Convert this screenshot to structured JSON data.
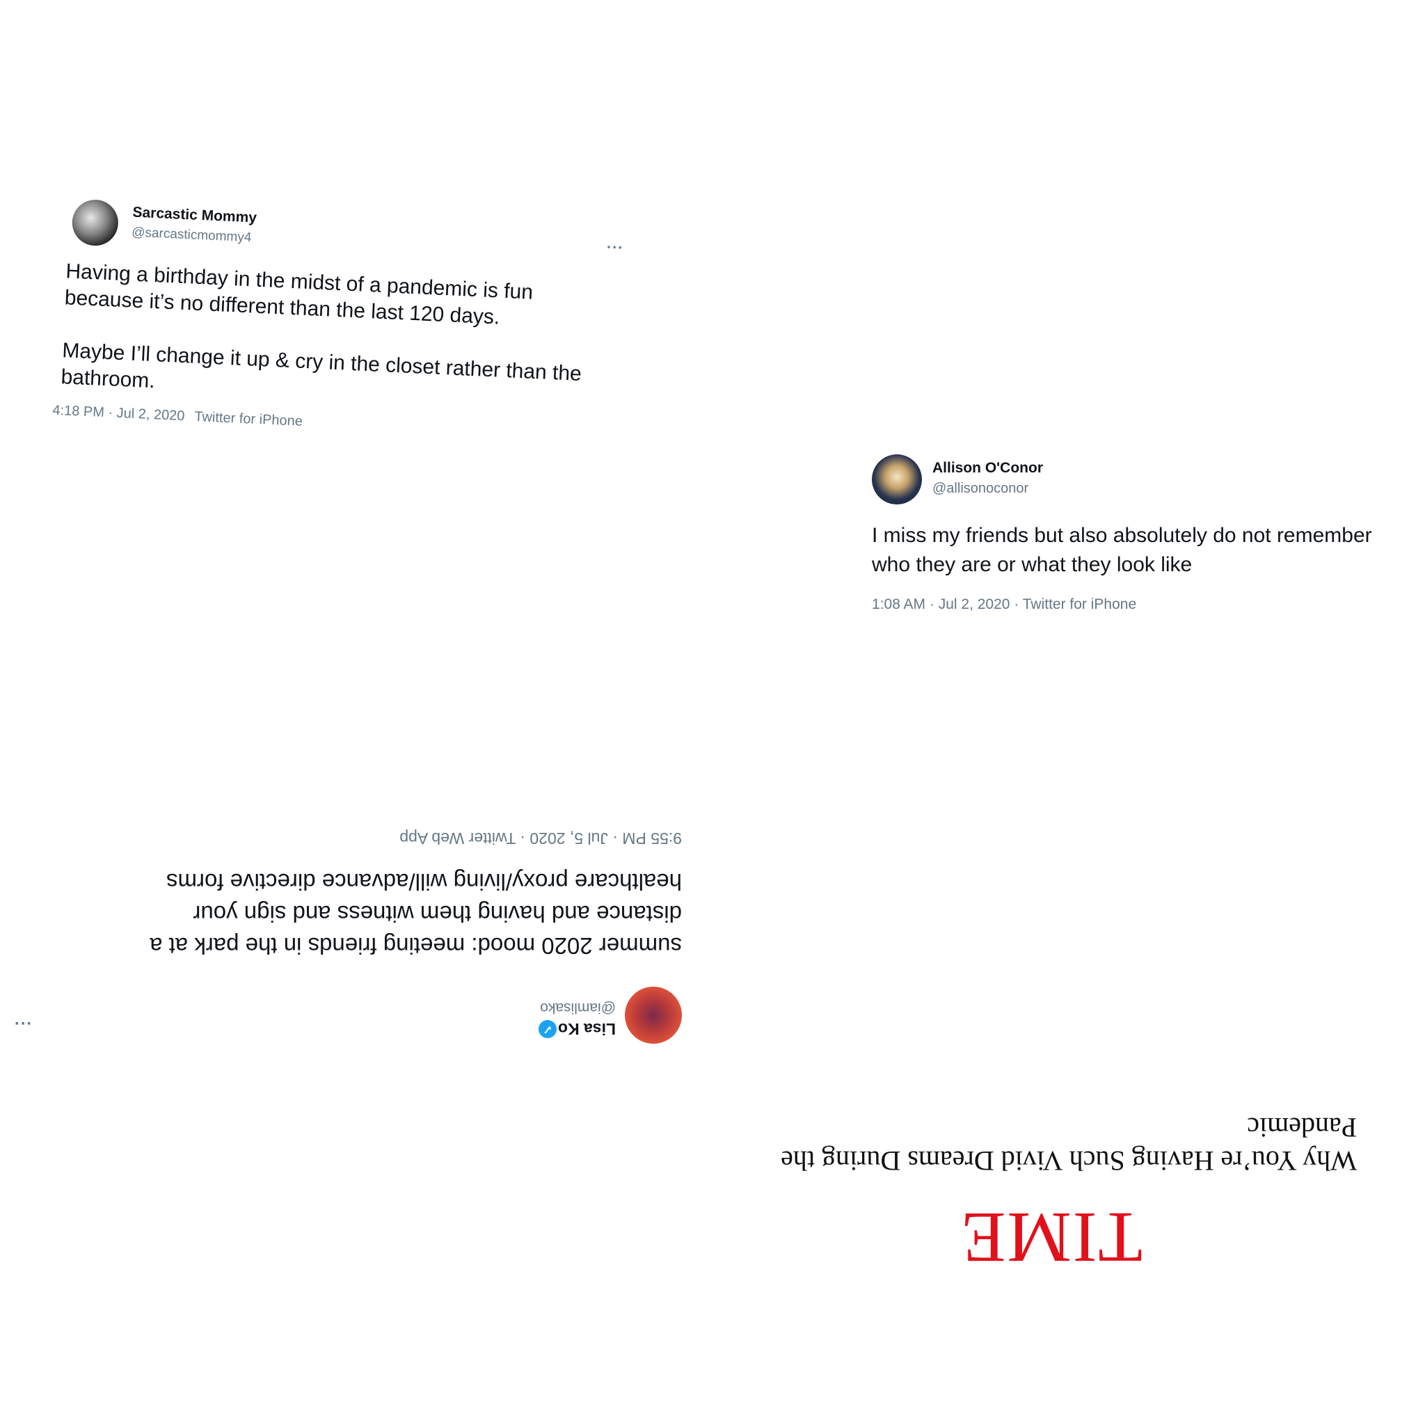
{
  "tweets": {
    "sarcastic": {
      "name": "Sarcastic Mommy",
      "handle": "@sarcasticmommy4",
      "avatar_icon": "avatar-photo",
      "more_icon": "more-options-icon",
      "more_label": "...",
      "lines": [
        "Having a birthday in the midst of a pandemic is fun",
        "because it’s no different than the last 120 days.",
        "Maybe I’ll change it up & cry in the closet rather than the",
        "bathroom."
      ],
      "timestamp": "4:18 PM · Jul 2, 2020",
      "source": "Twitter for iPhone"
    },
    "allison": {
      "name": "Allison O'Conor",
      "handle": "@allisonoconor",
      "avatar_icon": "avatar-photo",
      "lines": [
        "I miss my friends but also absolutely do not remember",
        "who they are or what they look like"
      ],
      "meta": "1:08 AM · Jul 2, 2020 · Twitter for iPhone"
    },
    "lisa": {
      "name": "Lisa Ko",
      "verified_icon": "verified-badge-icon",
      "verified_glyph": "✓",
      "handle": "@iamlisako",
      "avatar_icon": "avatar-photo",
      "more_label": "...",
      "lines": [
        "summer 2020 mood: meeting friends in the park at a",
        "distance and having them witness and sign your",
        "healthcare proxy/living will/advance directive forms"
      ],
      "meta": "9:55 PM · Jul 5, 2020 · Twitter Web App"
    }
  },
  "time_article": {
    "logo": "TIME",
    "logo_color": "#e1111b",
    "headline": "Why You’re Having Such Vivid Dreams During the Pandemic"
  },
  "colors": {
    "background": "#ffffff",
    "muted_text": "#657786",
    "verified_blue": "#1da1f2"
  }
}
